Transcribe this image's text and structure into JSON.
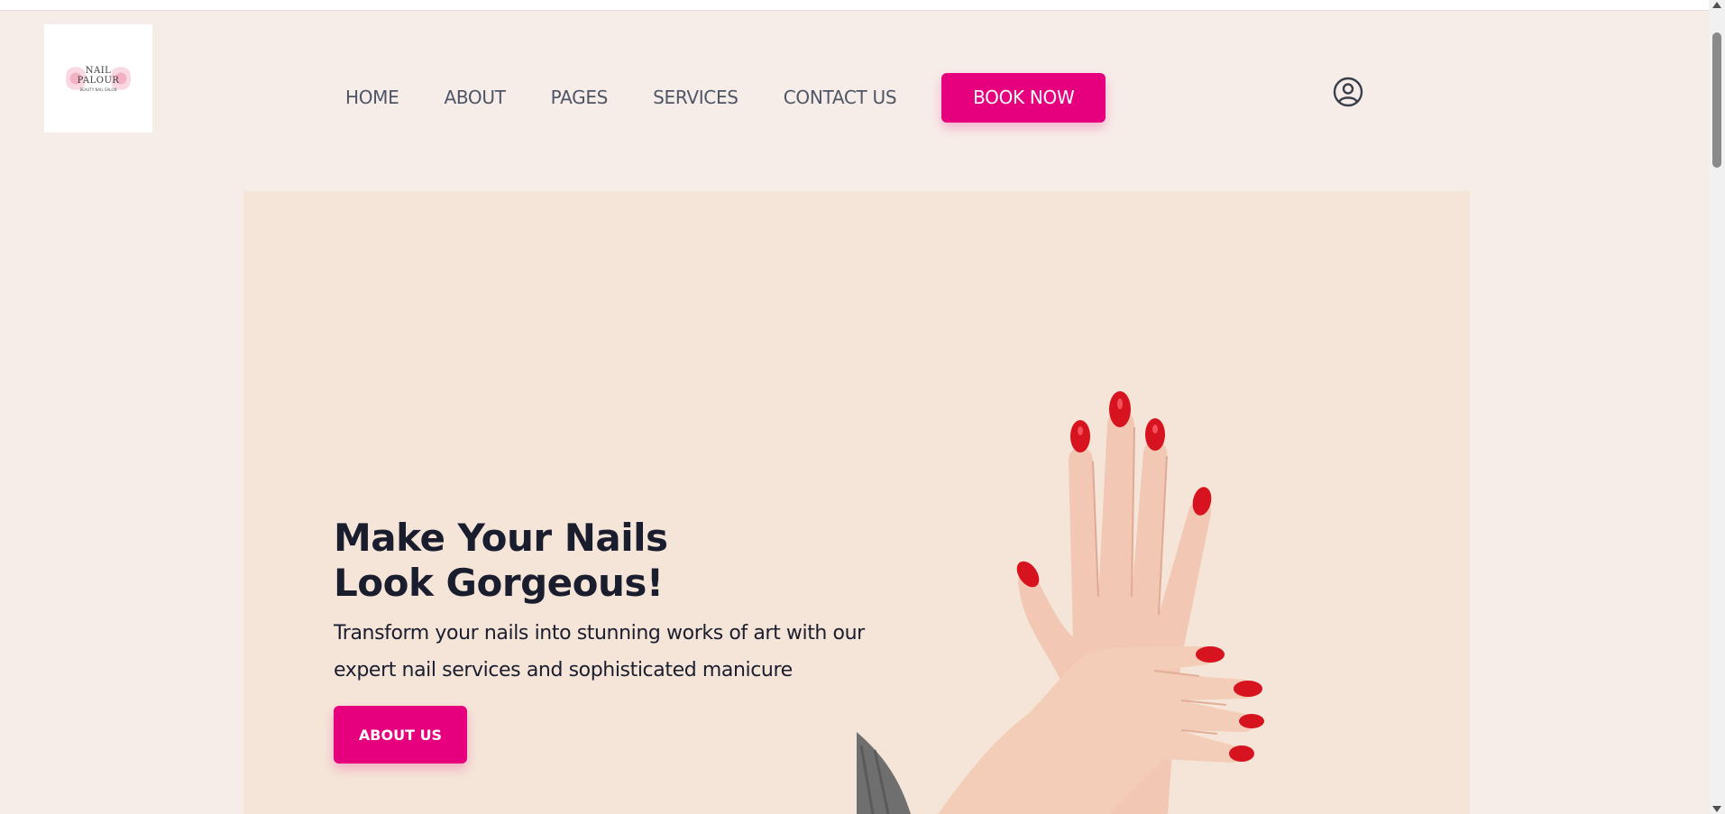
{
  "brand": {
    "logo_line1": "NAIL",
    "logo_line2": "PALOUR",
    "logo_tagline": "BEAUTY NAIL SALON"
  },
  "nav": {
    "items": [
      "HOME",
      "ABOUT",
      "PAGES",
      "SERVICES",
      "CONTACT US"
    ],
    "book_label": "BOOK NOW",
    "user_icon": "user-circle-icon"
  },
  "hero": {
    "title_line1": "Make Your Nails",
    "title_line2": "Look Gorgeous!",
    "description": "Transform your nails into stunning works of art with our expert nail services and sophisticated manicure",
    "button_label": "ABOUT US",
    "image": "hands-red-nails"
  },
  "colors": {
    "accent": "#e6007e",
    "page_bg": "#f7ede8",
    "hero_bg": "#f5e5d8",
    "heading": "#1a1d2e",
    "nav_text": "#4d5566",
    "nail": "#d6131f"
  }
}
